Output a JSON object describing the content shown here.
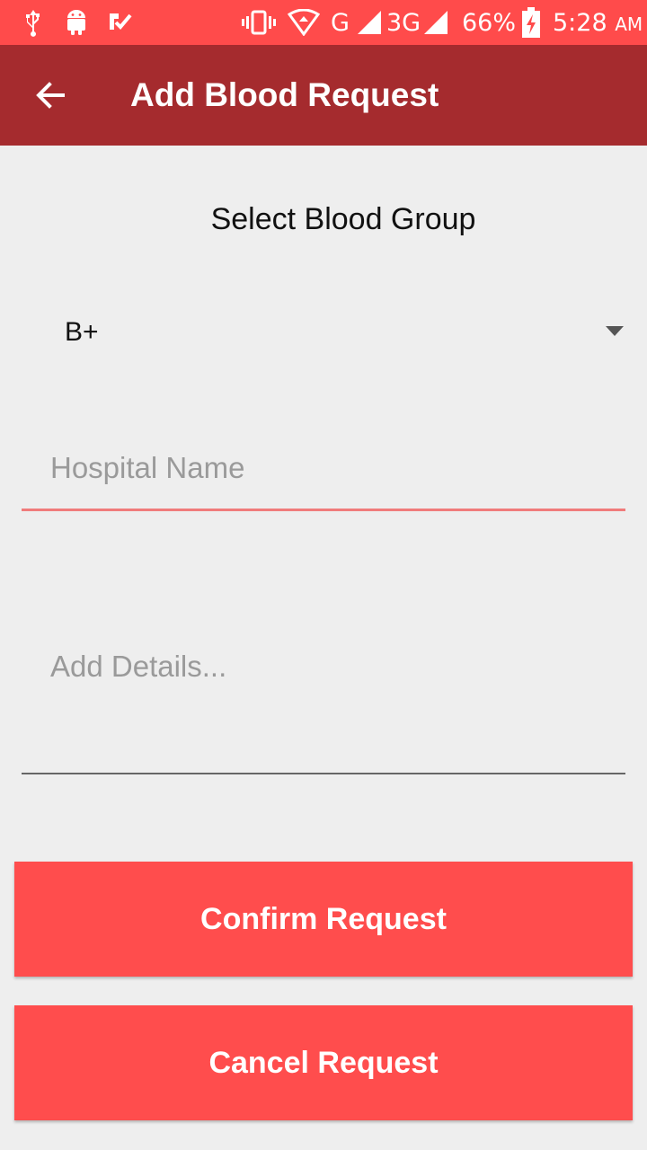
{
  "status_bar": {
    "battery": "66%",
    "time": "5:28",
    "ampm": "AM",
    "network_1": "G",
    "network_2": "3G",
    "icons": [
      "usb-icon",
      "android-icon",
      "check-app-icon",
      "vibrate-icon",
      "wifi-icon",
      "signal-icon",
      "signal-icon",
      "battery-charging-icon"
    ]
  },
  "app_bar": {
    "title": "Add Blood Request",
    "back_icon": "arrow-back-icon"
  },
  "form": {
    "blood_group_label": "Select Blood Group",
    "blood_group_value": "B+",
    "hospital_placeholder": "Hospital Name",
    "hospital_value": "",
    "details_placeholder": "Add Details...",
    "details_value": ""
  },
  "buttons": {
    "confirm": "Confirm Request",
    "cancel": "Cancel Request"
  },
  "colors": {
    "status_bar": "#ff4b4b",
    "app_bar": "#a52b2e",
    "button": "#ff4d4d",
    "background": "#eeeeee",
    "focus_underline": "#f07b7b"
  }
}
